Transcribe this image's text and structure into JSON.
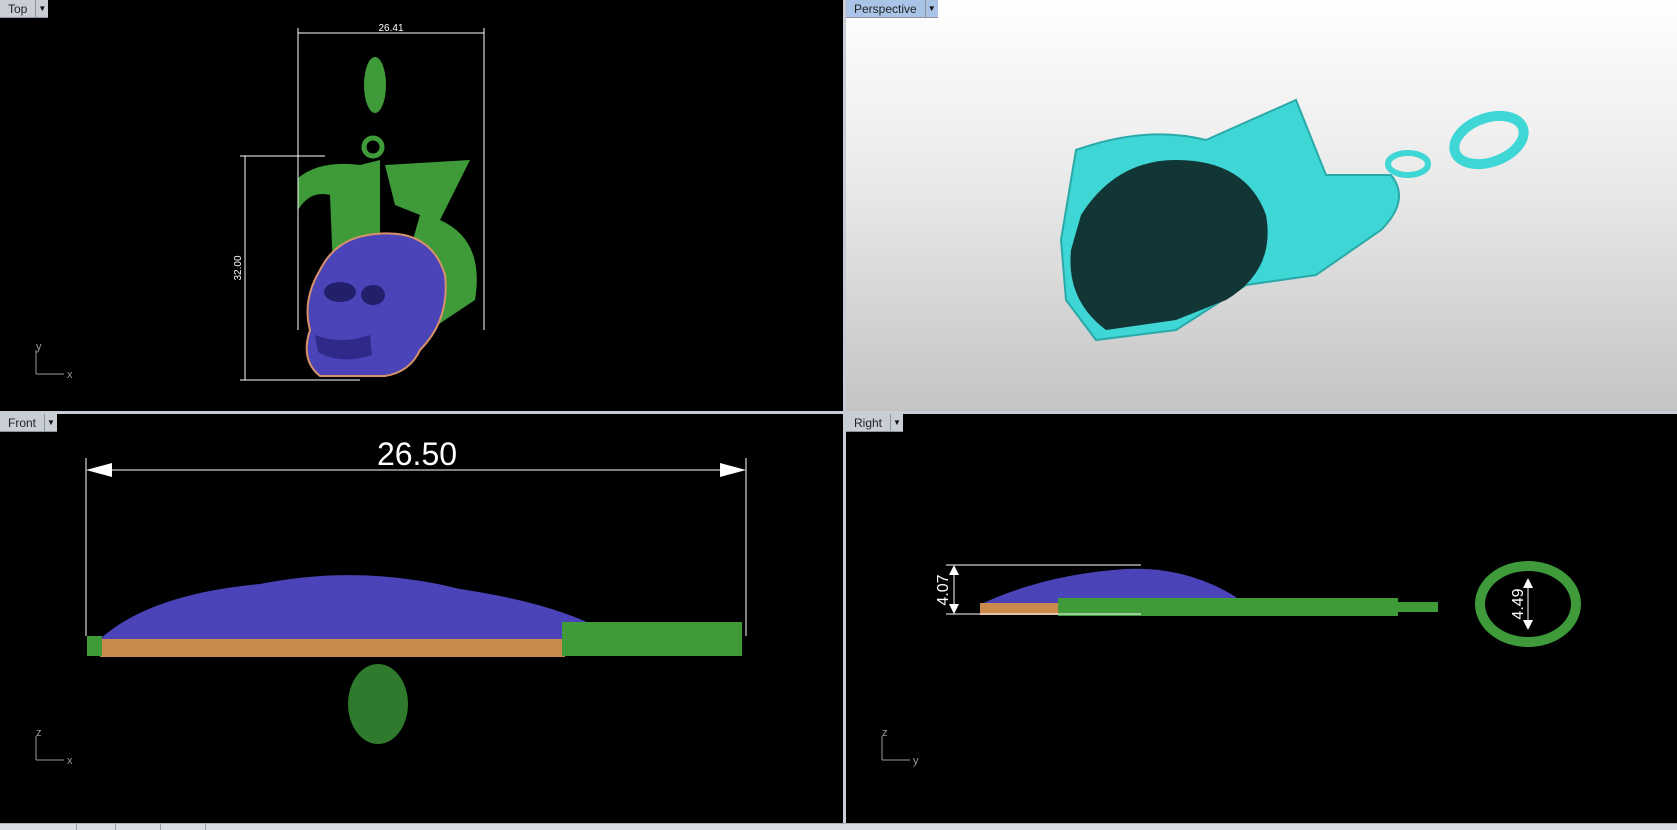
{
  "viewports": {
    "top": {
      "label": "Top",
      "dim_width": "26.41",
      "dim_height": "32.00",
      "axis_h": "x",
      "axis_v": "y"
    },
    "perspective": {
      "label": "Perspective"
    },
    "front": {
      "label": "Front",
      "dim_width": "26.50",
      "axis_h": "x",
      "axis_v": "z"
    },
    "right": {
      "label": "Right",
      "dim_thickness": "4.07",
      "dim_ring": "4.49",
      "axis_h": "y",
      "axis_v": "z"
    }
  },
  "colors": {
    "viewport_background": "#000000",
    "pendant_green": "#3f9a3a",
    "skull_blue": "#4a44b8",
    "base_orange": "#c98a4c",
    "perspective_cyan": "#3fd6d6",
    "active_tab": "#a9c4e6"
  },
  "icons": {
    "viewport_menu": "chevron-down-icon"
  }
}
